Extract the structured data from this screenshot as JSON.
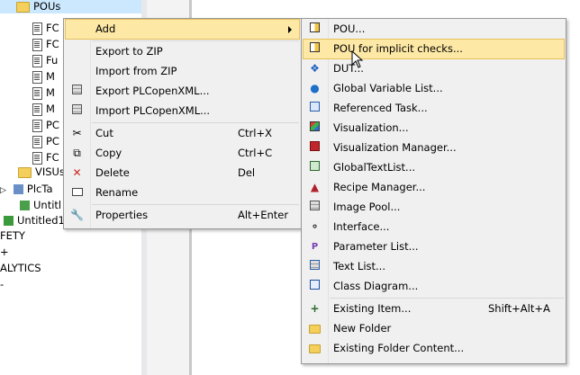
{
  "tree": {
    "pous_label": "POUs",
    "items": [
      "FC",
      "FC",
      "Fu",
      "M",
      "M",
      "M",
      "PC",
      "PC",
      "FC"
    ],
    "visus_label": "VISUs",
    "plctask_label": "PlcTa",
    "untitled_label": "Untitl",
    "untitled1_label": "Untitled1",
    "safety_label": "FETY",
    "plus_label": "+",
    "analytics_label": "ALYTICS",
    "dash_label": "-"
  },
  "context_menu": {
    "add": "Add",
    "export_zip": "Export to ZIP",
    "import_zip": "Import from ZIP",
    "export_xml": "Export PLCopenXML...",
    "import_xml": "Import PLCopenXML...",
    "cut": "Cut",
    "cut_sc": "Ctrl+X",
    "copy": "Copy",
    "copy_sc": "Ctrl+C",
    "delete": "Delete",
    "delete_sc": "Del",
    "rename": "Rename",
    "properties": "Properties",
    "properties_sc": "Alt+Enter"
  },
  "submenu": {
    "pou": "POU...",
    "pou_implicit": "POU for implicit checks...",
    "dut": "DUT...",
    "gvl": "Global Variable List...",
    "ref_task": "Referenced Task...",
    "visualization": "Visualization...",
    "vis_manager": "Visualization Manager...",
    "global_text": "GlobalTextList...",
    "recipe": "Recipe Manager...",
    "image_pool": "Image Pool...",
    "interface": "Interface...",
    "param_list": "Parameter List...",
    "text_list": "Text List...",
    "class_diagram": "Class Diagram...",
    "existing_item": "Existing Item...",
    "existing_item_sc": "Shift+Alt+A",
    "new_folder": "New Folder",
    "existing_folder": "Existing Folder Content..."
  },
  "colors": {
    "highlight": "#fde8a5",
    "selection": "#cce8ff",
    "menu_bg": "#f0f0f0"
  }
}
